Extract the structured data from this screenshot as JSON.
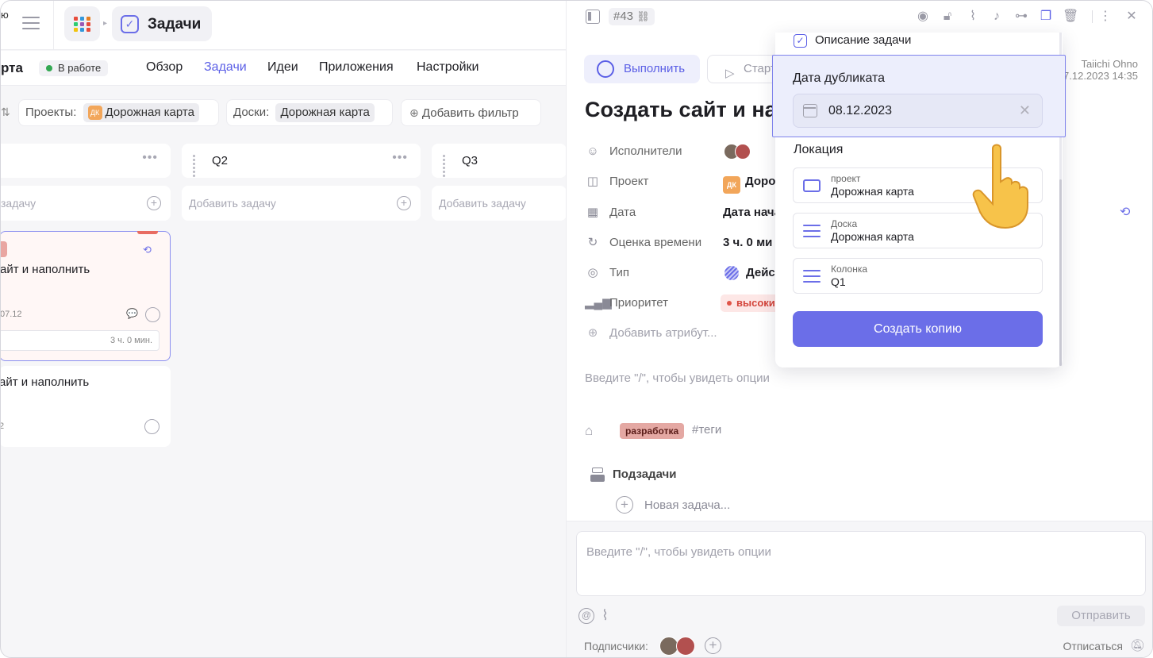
{
  "topbar": {
    "cut_label": "ю",
    "breadcrumb_title": "Задачи",
    "apps_colors": [
      "#e74c3c",
      "#3498db",
      "#e67e22",
      "#2ecc71",
      "#9b59b6",
      "#e74c3c",
      "#f1c40f",
      "#3498db",
      "#e74c3c"
    ]
  },
  "nav": {
    "project_name": "рта",
    "status": "В работе",
    "tabs": [
      "Обзор",
      "Задачи",
      "Идеи",
      "Приложения",
      "Настройки"
    ],
    "active_tab": "Задачи"
  },
  "filters": {
    "projects_label": "Проекты:",
    "projects_value": "Дорожная карта",
    "projects_badge": "ДК",
    "boards_label": "Доски:",
    "boards_value": "Дорожная карта",
    "add_filter": "Добавить фильтр"
  },
  "columns": [
    {
      "name": "",
      "add_placeholder": "задачу"
    },
    {
      "name": "Q2",
      "add_placeholder": "Добавить задачу"
    },
    {
      "name": "Q3",
      "add_placeholder": "Добавить задачу"
    }
  ],
  "cards": [
    {
      "title": "айт и наполнить",
      "date": "07.12",
      "estimate": "3 ч. 0 мин."
    },
    {
      "title": "айт и наполнить",
      "date": "2"
    }
  ],
  "panel": {
    "task_id": "#43",
    "complete_btn": "Выполнить",
    "start_btn": "Старт",
    "author_name": "Taiichi Ohno",
    "author_date": "07.12.2023 14:35",
    "title": "Создать сайт и на",
    "attributes": [
      {
        "icon": "assignees-icon",
        "label": "Исполнители",
        "value": ""
      },
      {
        "icon": "project-icon",
        "label": "Проект",
        "value": "Доро"
      },
      {
        "icon": "calendar-icon",
        "label": "Дата",
        "value": "Дата нача"
      },
      {
        "icon": "time-estimate-icon",
        "label": "Оценка времени",
        "value": "3 ч. 0 ми"
      },
      {
        "icon": "type-icon",
        "label": "Тип",
        "value": "Дейс"
      },
      {
        "icon": "priority-icon",
        "label": "Приоритет",
        "value": "высоки"
      }
    ],
    "project_badge": "ДК",
    "add_attribute": "Добавить атрибут...",
    "description_placeholder": "Введите \"/\", чтобы увидеть опции",
    "tag": "разработка",
    "tags_placeholder": "#теги",
    "subtasks_label": "Подзадачи",
    "new_subtask": "Новая задача...",
    "comment_placeholder": "Введите \"/\", чтобы увидеть опции",
    "send_btn": "Отправить",
    "subscribers_label": "Подписчики:",
    "unsubscribe": "Отписаться"
  },
  "popup": {
    "description_option": "Описание задачи",
    "description_checked": true,
    "duplicate_date_label": "Дата дубликата",
    "duplicate_date_value": "08.12.2023",
    "location_label": "Локация",
    "locations": [
      {
        "key": "проект",
        "value": "Дорожная карта"
      },
      {
        "key": "Доска",
        "value": "Дорожная карта"
      },
      {
        "key": "Колонка",
        "value": "Q1"
      }
    ],
    "create_copy_btn": "Создать копию"
  },
  "colors": {
    "accent": "#5b5fe6",
    "button": "#6b6ee8",
    "status_green": "#33a852",
    "priority_red": "#d4453b",
    "tag_bg": "#e4a8a3"
  }
}
